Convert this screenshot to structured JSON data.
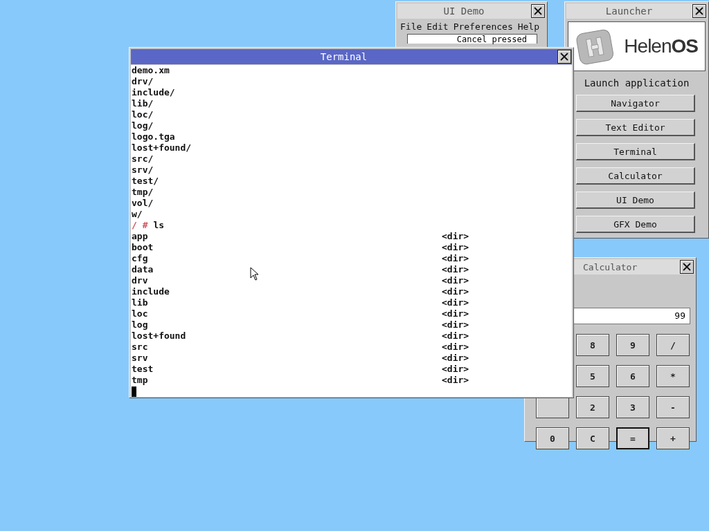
{
  "ui_demo": {
    "title": "UI Demo",
    "menu": [
      "File",
      "Edit",
      "Preferences",
      "Help"
    ],
    "field": {
      "value": "Cancel pressed"
    }
  },
  "launcher": {
    "title": "Launcher",
    "logo_text": "Helen**OS**",
    "heading": "Launch application",
    "buttons": [
      "Navigator",
      "Text Editor",
      "Terminal",
      "Calculator",
      "UI Demo",
      "GFX Demo"
    ]
  },
  "calculator": {
    "title": "Calculator",
    "display": "99",
    "rows": [
      [
        {
          "kind": "covered"
        },
        {
          "kind": "key",
          "label": "8",
          "default": false
        },
        {
          "label": "9",
          "default": false
        },
        {
          "label": "/",
          "default": false
        }
      ],
      [
        {
          "kind": "covered"
        },
        {
          "kind": "key",
          "label": "5",
          "default": false
        },
        {
          "label": "6",
          "default": false
        },
        {
          "label": "*",
          "default": false
        }
      ],
      [
        {
          "kind": "blank"
        },
        {
          "kind": "key",
          "label": "2",
          "default": false
        },
        {
          "label": "3",
          "default": false
        },
        {
          "label": "-",
          "default": false
        }
      ],
      [
        {
          "label": "0",
          "default": false
        },
        {
          "label": "C",
          "default": false
        },
        {
          "label": "=",
          "default": true
        },
        {
          "label": "+",
          "default": false
        }
      ]
    ]
  },
  "terminal": {
    "title": "Terminal",
    "lines": [
      "demo.xm",
      "drv/",
      "include/",
      "lib/",
      "loc/",
      "log/",
      "logo.tga",
      "lost+found/",
      "src/",
      "srv/",
      "test/",
      "tmp/",
      "vol/",
      "w/"
    ],
    "prompt": "/ #",
    "command": "ls",
    "entries": [
      {
        "name": "app",
        "type": "<dir>"
      },
      {
        "name": "boot",
        "type": "<dir>"
      },
      {
        "name": "cfg",
        "type": "<dir>"
      },
      {
        "name": "data",
        "type": "<dir>"
      },
      {
        "name": "drv",
        "type": "<dir>"
      },
      {
        "name": "include",
        "type": "<dir>"
      },
      {
        "name": "lib",
        "type": "<dir>"
      },
      {
        "name": "loc",
        "type": "<dir>"
      },
      {
        "name": "log",
        "type": "<dir>"
      },
      {
        "name": "lost+found",
        "type": "<dir>"
      },
      {
        "name": "src",
        "type": "<dir>"
      },
      {
        "name": "srv",
        "type": "<dir>"
      },
      {
        "name": "test",
        "type": "<dir>"
      },
      {
        "name": "tmp",
        "type": "<dir>"
      }
    ]
  }
}
